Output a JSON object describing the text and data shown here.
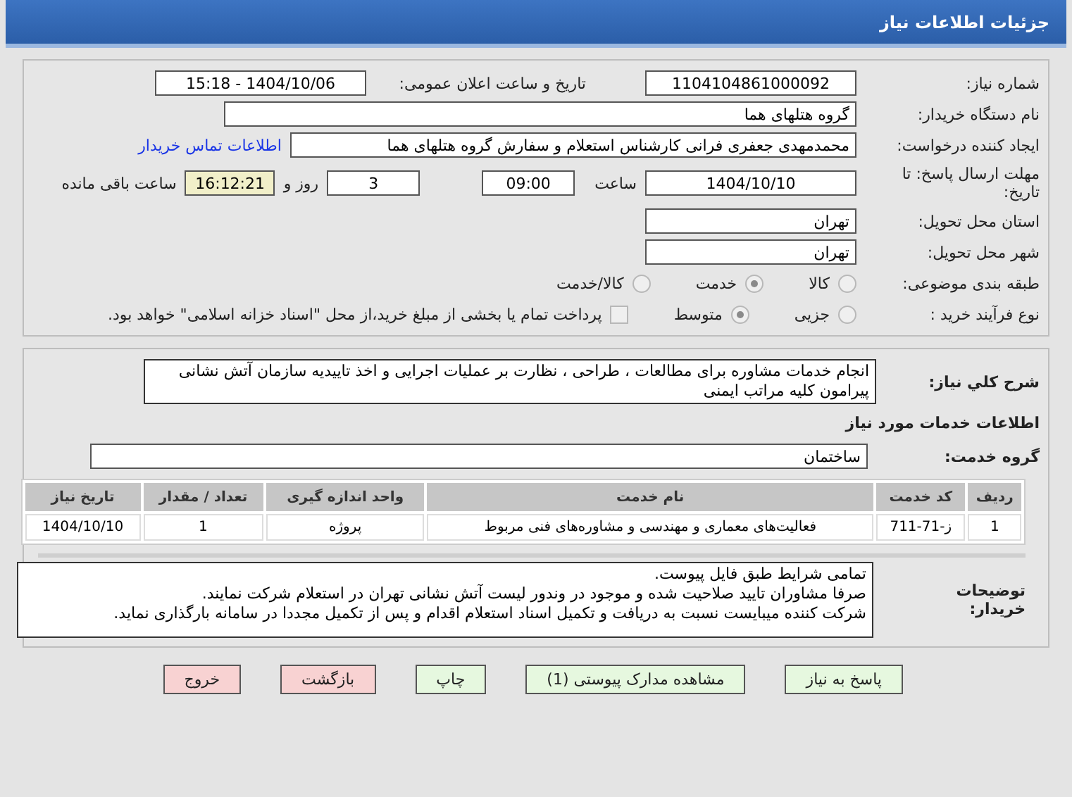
{
  "header": {
    "title": "جزئیات اطلاعات نیاز"
  },
  "need_number": {
    "label": "شماره نیاز:",
    "value": "1104104861000092"
  },
  "announce_date": {
    "label": "تاریخ و ساعت اعلان عمومی:",
    "value": "1404/10/06 - 15:18"
  },
  "buyer_org": {
    "label": "نام دستگاه خریدار:",
    "value": "گروه هتلهای هما"
  },
  "requester": {
    "label": "ایجاد کننده درخواست:",
    "value": "محمدمهدی جعفری فرانی کارشناس استعلام و سفارش گروه هتلهای هما",
    "link": "اطلاعات تماس خریدار"
  },
  "deadline": {
    "label": "مهلت ارسال پاسخ: تا تاریخ:",
    "date": "1404/10/10",
    "time_label": "ساعت",
    "time": "09:00",
    "days": "3",
    "days_label": "روز و",
    "remaining": "16:12:21",
    "remaining_label": "ساعت باقی مانده"
  },
  "province": {
    "label": "استان محل تحویل:",
    "value": "تهران"
  },
  "city": {
    "label": "شهر محل تحویل:",
    "value": "تهران"
  },
  "category": {
    "label": "طبقه بندی موضوعی:",
    "options": [
      {
        "label": "کالا",
        "selected": false
      },
      {
        "label": "خدمت",
        "selected": true
      },
      {
        "label": "کالا/خدمت",
        "selected": false
      }
    ]
  },
  "process": {
    "label": "نوع فرآیند خرید :",
    "options": [
      {
        "label": "جزیی",
        "selected": false
      },
      {
        "label": "متوسط",
        "selected": true
      }
    ],
    "treasury": {
      "checked": false,
      "label": "پرداخت تمام یا بخشی از مبلغ خرید،از محل \"اسناد خزانه اسلامی\" خواهد بود."
    }
  },
  "description": {
    "label": "شرح کلي نياز:",
    "value": "انجام خدمات مشاوره برای مطالعات ، طراحی ، نظارت بر عملیات اجرایی و اخذ تاییدیه سازمان آتش نشانی پیرامون کلیه مراتب ایمنی"
  },
  "services_heading": "اطلاعات خدمات مورد نياز",
  "service_group": {
    "label": "گروه خدمت:",
    "value": "ساختمان"
  },
  "table": {
    "columns": [
      "ردیف",
      "کد خدمت",
      "نام خدمت",
      "واحد اندازه گیری",
      "تعداد / مقدار",
      "تاریخ نیاز"
    ],
    "rows": [
      [
        "1",
        "ز-71-711",
        "فعالیت‌های معماری و مهندسی و مشاوره‌های فنی مربوط",
        "پروژه",
        "1",
        "1404/10/10"
      ]
    ]
  },
  "buyer_notes": {
    "label": "توضیحات خریدار:",
    "lines": [
      "تمامی شرایط طبق فایل پیوست.",
      "صرفا مشاوران تایید صلاحیت شده و موجود در وندور لیست آتش نشانی تهران در استعلام شرکت نمایند.",
      "شرکت کننده میبایست نسبت به دریافت و تکمیل اسناد استعلام اقدام و پس از تکمیل مجددا در سامانه بارگذاری نماید."
    ]
  },
  "buttons": [
    {
      "label": "پاسخ به نیاز",
      "kind": "primary"
    },
    {
      "label": "مشاهده مدارک پیوستی (1)",
      "kind": "primary"
    },
    {
      "label": "چاپ",
      "kind": "primary"
    },
    {
      "label": "بازگشت",
      "kind": "danger"
    },
    {
      "label": "خروج",
      "kind": "danger"
    }
  ]
}
